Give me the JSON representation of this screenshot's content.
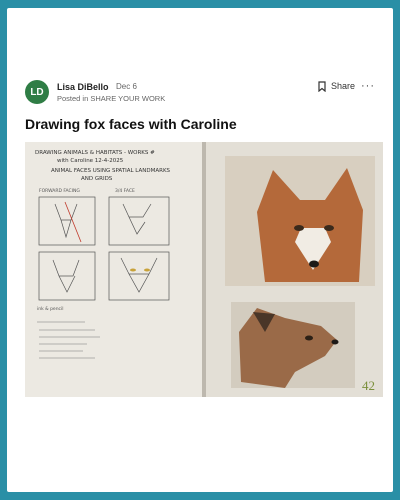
{
  "post": {
    "author": {
      "name": "Lisa DiBello",
      "initials": "LD",
      "date": "Dec 6"
    },
    "posted_in": "Posted in SHARE YOUR WORK",
    "title": "Drawing fox faces with Caroline",
    "actions": {
      "share_label": "Share",
      "more_label": "···"
    }
  },
  "sketchbook": {
    "header_line1": "DRAWING ANIMALS & HABITATS - WORKS #",
    "header_line2": "with Caroline 12-4-2025",
    "subtitle_line1": "ANIMAL FACES USING SPATIAL LANDMARKS",
    "subtitle_line2": "AND GRIDS",
    "col_left": "FORWARD FACING",
    "col_right": "3/4 FACE",
    "note": "ink & pencil",
    "page_number": "42"
  },
  "colors": {
    "background": "#2a8fa6",
    "avatar": "#2f7d45"
  }
}
